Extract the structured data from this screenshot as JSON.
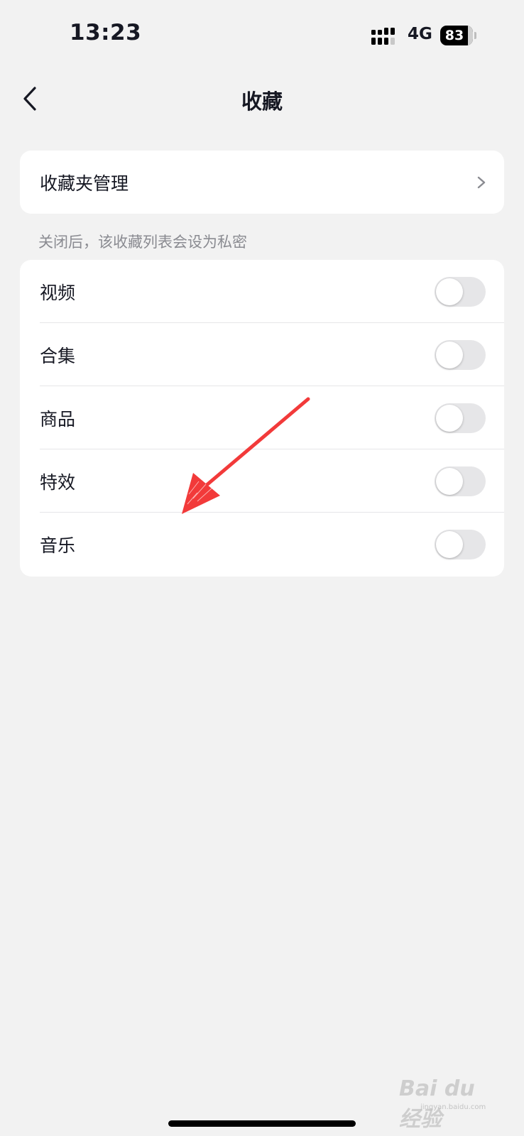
{
  "status_bar": {
    "time": "13:23",
    "network": "4G",
    "battery": "83"
  },
  "nav": {
    "title": "收藏",
    "back_icon": "chevron-left-icon"
  },
  "manage": {
    "label": "收藏夹管理",
    "chevron_icon": "chevron-right-icon"
  },
  "section_hint": "关闭后，该收藏列表会设为私密",
  "items": [
    {
      "label": "视频",
      "enabled": false
    },
    {
      "label": "合集",
      "enabled": false
    },
    {
      "label": "商品",
      "enabled": false
    },
    {
      "label": "特效",
      "enabled": false
    },
    {
      "label": "音乐",
      "enabled": false
    }
  ],
  "colors": {
    "background": "#f2f2f2",
    "card": "#ffffff",
    "toggle_off": "#e6e6e8",
    "annotation_arrow": "#f23a3a"
  },
  "watermark": {
    "text": "Bai du 经验",
    "sub": "jingyan.baidu.com"
  }
}
